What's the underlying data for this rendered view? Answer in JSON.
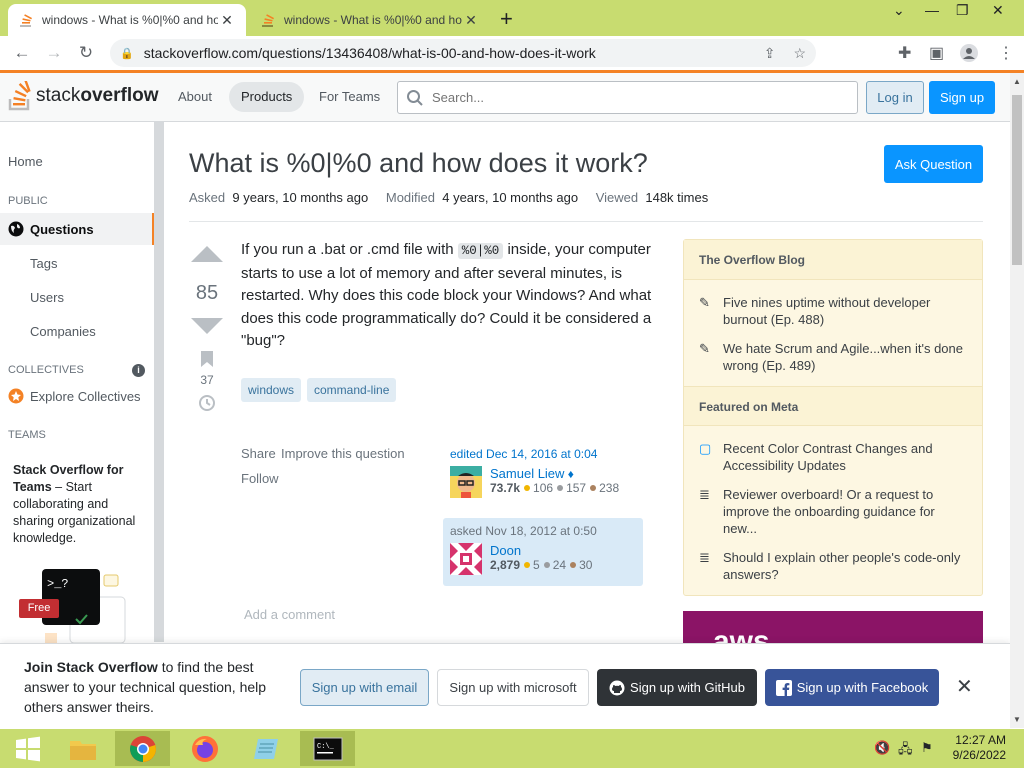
{
  "browser": {
    "tabs": [
      {
        "title": "windows - What is %0|%0 and how does it work?"
      },
      {
        "title": "windows - What is %0|%0 and how does it work?"
      }
    ],
    "url": "stackoverflow.com/questions/13436408/what-is-00-and-how-does-it-work"
  },
  "so_header": {
    "logo_plain": "stack",
    "logo_bold": "overflow",
    "about": "About",
    "products": "Products",
    "for_teams": "For Teams",
    "search_placeholder": "Search...",
    "login": "Log in",
    "signup": "Sign up"
  },
  "left_nav": {
    "home": "Home",
    "public": "PUBLIC",
    "questions": "Questions",
    "tags": "Tags",
    "users": "Users",
    "companies": "Companies",
    "collectives": "COLLECTIVES",
    "explore": "Explore Collectives",
    "teams": "TEAMS",
    "teams_title": "Stack Overflow for Teams",
    "teams_text": " – Start collaborating and sharing organizational knowledge.",
    "free_badge": "Free"
  },
  "question": {
    "title": "What is %0|%0 and how does it work?",
    "ask_button": "Ask Question",
    "asked_label": "Asked",
    "asked_value": "9 years, 10 months ago",
    "modified_label": "Modified",
    "modified_value": "4 years, 10 months ago",
    "viewed_label": "Viewed",
    "viewed_value": "148k times",
    "votes": "85",
    "bookmarks": "37",
    "body_part1": "If you run a .bat or .cmd file with ",
    "body_code": "%0|%0",
    "body_part2": " inside, your computer starts to use a lot of memory and after several minutes, is restarted. Why does this code block your Windows? And what does this code programmatically do? Could it be considered a \"bug\"?",
    "tags": [
      "windows",
      "command-line"
    ],
    "share": "Share",
    "improve": "Improve this question",
    "follow": "Follow",
    "add_comment": "Add a comment"
  },
  "editor": {
    "edited": "edited Dec 14, 2016 at 0:04",
    "name": "Samuel Liew",
    "diamond": "♦",
    "rep": "73.7k",
    "gold": "106",
    "silver": "157",
    "bronze": "238"
  },
  "asker": {
    "asked": "asked Nov 18, 2012 at 0:50",
    "name": "Doon",
    "rep": "2,879",
    "gold": "5",
    "silver": "24",
    "bronze": "30"
  },
  "blog": {
    "heading": "The Overflow Blog",
    "items": [
      "Five nines uptime without developer burnout (Ep. 488)",
      "We hate Scrum and Agile...when it's done wrong (Ep. 489)"
    ],
    "meta_heading": "Featured on Meta",
    "meta_items": [
      "Recent Color Contrast Changes and Accessibility Updates",
      "Reviewer overboard! Or a request to improve the onboarding guidance for new...",
      "Should I explain other people's code-only answers?"
    ],
    "ad_text": "aws"
  },
  "banner": {
    "join_bold": "Join Stack Overflow",
    "join_rest": " to find the best answer to your technical question, help others answer theirs.",
    "email": "Sign up with email",
    "microsoft": "Sign up with microsoft",
    "github": "Sign up with GitHub",
    "facebook": "Sign up with Facebook"
  },
  "taskbar": {
    "time": "12:27 AM",
    "date": "9/26/2022"
  },
  "colors": {
    "chrome_frame": "#c8dc70",
    "so_orange": "#f48225",
    "so_blue": "#0a95ff"
  }
}
